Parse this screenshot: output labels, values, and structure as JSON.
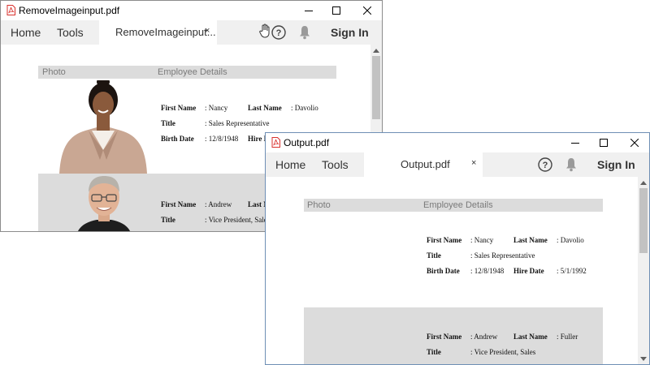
{
  "window1": {
    "title": "RemoveImageinput.pdf",
    "menu": {
      "home": "Home",
      "tools": "Tools"
    },
    "tab": {
      "label": "RemoveImageinput...",
      "close": "×"
    },
    "sign_in": "Sign In",
    "table": {
      "header_photo": "Photo",
      "header_details": "Employee Details",
      "rows": [
        {
          "first_name_label": "First Name",
          "first_name": ": Nancy",
          "last_name_label": "Last Name",
          "last_name": ": Davolio",
          "title_label": "Title",
          "title": ": Sales Representative",
          "birth_label": "Birth Date",
          "birth": ": 12/8/1948",
          "hire_label": "Hire D"
        },
        {
          "first_name_label": "First Name",
          "first_name": ": Andrew",
          "last_name_label": "Last N",
          "title_label": "Title",
          "title": ": Vice President, Sale"
        }
      ]
    }
  },
  "window2": {
    "title": "Output.pdf",
    "menu": {
      "home": "Home",
      "tools": "Tools"
    },
    "tab": {
      "label": "Output.pdf",
      "close": "×"
    },
    "sign_in": "Sign In",
    "table": {
      "header_photo": "Photo",
      "header_details": "Employee Details",
      "rows": [
        {
          "first_name_label": "First Name",
          "first_name": ": Nancy",
          "last_name_label": "Last Name",
          "last_name": ": Davolio",
          "title_label": "Title",
          "title": ": Sales Representative",
          "birth_label": "Birth Date",
          "birth": ": 12/8/1948",
          "hire_label": "Hire Date",
          "hire": ": 5/1/1992"
        },
        {
          "first_name_label": "First Name",
          "first_name": ": Andrew",
          "last_name_label": "Last Name",
          "last_name": ": Fuller",
          "title_label": "Title",
          "title": ": Vice President, Sales"
        }
      ]
    }
  },
  "colors": {
    "pdf_red": "#d9302c",
    "header_gray": "#dcdcdc",
    "menubar_bg": "#f0f0f0"
  },
  "icons": [
    "pdf-file-icon",
    "minimize-icon",
    "maximize-icon",
    "close-icon",
    "hand-tool-icon",
    "help-icon",
    "bell-icon",
    "scroll-up-icon",
    "scroll-down-icon"
  ]
}
